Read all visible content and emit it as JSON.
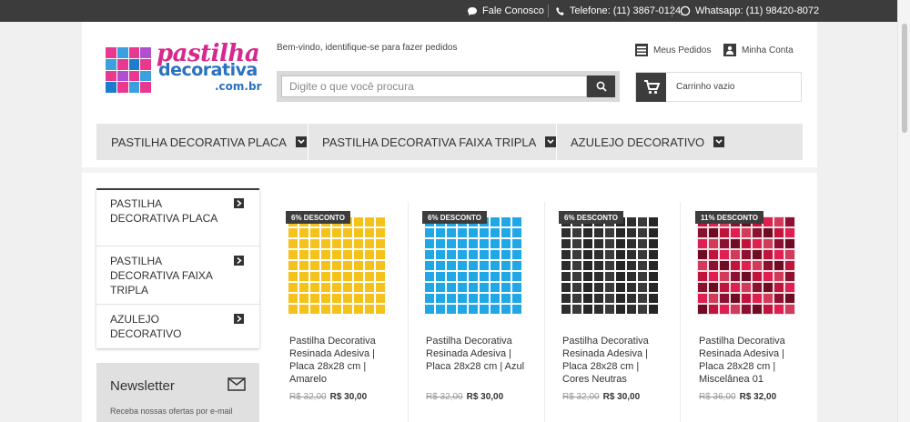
{
  "topbar": {
    "contact": "Fale Conosco",
    "phone": "Telefone: (11) 3867-0124",
    "whatsapp": "Whatsapp: (11) 98420-8072"
  },
  "logo": {
    "line1": "pastilha",
    "line2": "decorativa",
    "line3": ".com.br"
  },
  "header": {
    "welcome": "Bem-vindo, identifique-se para fazer pedidos",
    "search_placeholder": "Digite o que você procura",
    "my_orders": "Meus Pedidos",
    "my_account": "Minha Conta",
    "cart": "Carrinho vazio"
  },
  "nav": {
    "items": [
      "PASTILHA DECORATIVA PLACA",
      "PASTILHA DECORATIVA FAIXA TRIPLA",
      "AZULEJO DECORATIVO"
    ]
  },
  "sidebar": {
    "items": [
      "PASTILHA DECORATIVA PLACA",
      "PASTILHA DECORATIVA FAIXA TRIPLA",
      "AZULEJO DECORATIVO"
    ]
  },
  "newsletter": {
    "title": "Newsletter",
    "subtitle": "Receba nossas ofertas por e-mail"
  },
  "products": [
    {
      "badge": "6% DESCONTO",
      "name": "Pastilha Decorativa Resinada Adesiva | Placa 28x28 cm | Amarelo",
      "old_price": "R$ 32,00",
      "price": "R$ 30,00",
      "colors": [
        "#f5c21b"
      ]
    },
    {
      "badge": "6% DESCONTO",
      "name": "Pastilha Decorativa Resinada Adesiva | Placa 28x28 cm | Azul",
      "old_price": "R$ 32,00",
      "price": "R$ 30,00",
      "colors": [
        "#1fa7e6"
      ]
    },
    {
      "badge": "6% DESCONTO",
      "name": "Pastilha Decorativa Resinada Adesiva | Placa 28x28 cm | Cores Neutras",
      "old_price": "R$ 32,00",
      "price": "R$ 30,00",
      "colors": [
        "#2e2e2e",
        "#3a3a3a",
        "#262626"
      ]
    },
    {
      "badge": "11% DESCONTO",
      "name": "Pastilha Decorativa Resinada Adesiva | Placa 28x28 cm | Miscelânea 01",
      "old_price": "R$ 36,00",
      "price": "R$ 32,00",
      "colors": [
        "#c0143c",
        "#8c1030",
        "#e01e50",
        "#6e0c24",
        "#d23a5a"
      ]
    }
  ],
  "colors": {
    "dark": "#3c3c3c",
    "logo_pink": "#d6288d",
    "logo_blue": "#2a72c0"
  }
}
